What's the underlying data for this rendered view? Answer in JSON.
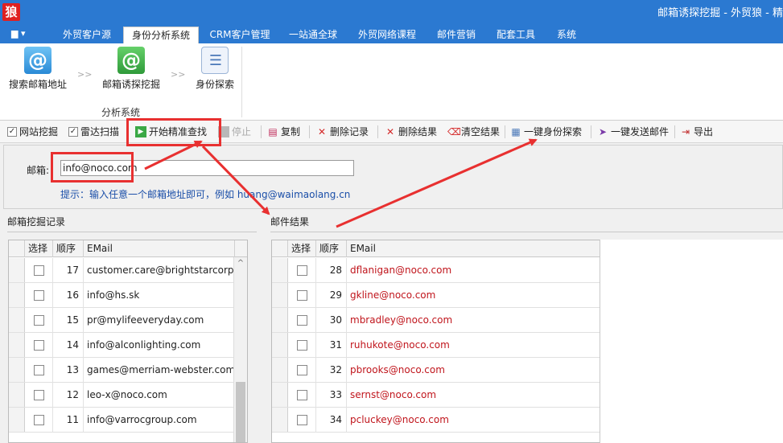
{
  "window": {
    "app_icon_text": "狼",
    "title": "邮箱诱探挖掘 - 外贸狼 - 精"
  },
  "menubar": {
    "menu_button": "▆ ▾",
    "tabs": [
      {
        "label": "外贸客户源"
      },
      {
        "label": "身份分析系统",
        "active": true
      },
      {
        "label": "CRM客户管理"
      },
      {
        "label": "一站通全球"
      },
      {
        "label": "外贸网络课程"
      },
      {
        "label": "邮件营销"
      },
      {
        "label": "配套工具"
      },
      {
        "label": "系统"
      }
    ]
  },
  "ribbon": {
    "buttons": [
      {
        "label": "搜索邮箱地址",
        "icon": "email-at-icon"
      },
      {
        "label": "邮箱诱探挖掘",
        "icon": "email-probe-icon"
      },
      {
        "label": "身份探索",
        "icon": "identity-card-icon"
      }
    ],
    "separator": ">>",
    "group_label": "分析系统"
  },
  "toolbar": {
    "website_mining": "网站挖掘",
    "radar_scan": "雷达扫描",
    "start_search": "开始精准查找",
    "stop": "停止",
    "copy": "复制",
    "delete_record": "删除记录",
    "delete_result": "删除结果",
    "clear_result": "清空结果",
    "identity_explore": "一键身份探索",
    "send_mail": "一键发送邮件",
    "export": "导出"
  },
  "search": {
    "email_label": "邮箱:",
    "email_value": "info@noco.com",
    "hint": "提示：输入任意一个邮箱地址即可，例如 huang@waimaolang.cn"
  },
  "left_panel": {
    "title": "邮箱挖掘记录",
    "columns": [
      "选择",
      "顺序",
      "EMail"
    ],
    "rows": [
      {
        "order": "17",
        "email": "customer.care@brightstarcorp.in"
      },
      {
        "order": "16",
        "email": "info@hs.sk"
      },
      {
        "order": "15",
        "email": "pr@mylifeeveryday.com"
      },
      {
        "order": "14",
        "email": "info@alconlighting.com"
      },
      {
        "order": "13",
        "email": "games@merriam-webster.com"
      },
      {
        "order": "12",
        "email": "leo-x@noco.com"
      },
      {
        "order": "11",
        "email": "info@varrocgroup.com"
      }
    ]
  },
  "right_panel": {
    "title": "邮件结果",
    "columns": [
      "选择",
      "顺序",
      "EMail"
    ],
    "rows": [
      {
        "order": "28",
        "email": "dflanigan@noco.com"
      },
      {
        "order": "29",
        "email": "gkline@noco.com"
      },
      {
        "order": "30",
        "email": "mbradley@noco.com"
      },
      {
        "order": "31",
        "email": "ruhukote@noco.com"
      },
      {
        "order": "32",
        "email": "pbrooks@noco.com"
      },
      {
        "order": "33",
        "email": "sernst@noco.com"
      },
      {
        "order": "34",
        "email": "pcluckey@noco.com"
      }
    ]
  },
  "colors": {
    "titlebar": "#2b79d1",
    "annotation_red": "#e83030",
    "result_email": "#c0151c",
    "hint_blue": "#1a4ea8"
  }
}
